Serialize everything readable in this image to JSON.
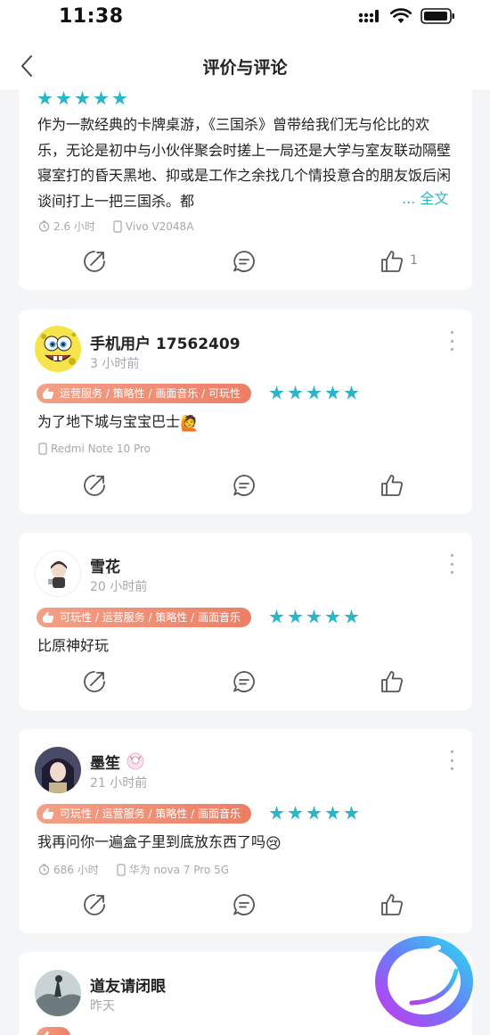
{
  "status": {
    "time": "11:38"
  },
  "nav": {
    "title": "评价与评论"
  },
  "top_review": {
    "text": "作为一款经典的卡牌桌游，《三国杀》曾带给我们无与伦比的欢乐，无论是初中与小伙伴聚会时搓上一局还是大学与室友联动隔壁寝室打的昏天黑地、抑或是工作之余找几个情投意合的朋友饭后闲谈间打上一把三国杀。都",
    "more": "... 全文",
    "playtime": "2.6 小时",
    "device": "Vivo V2048A",
    "likes": "1",
    "rating": 5
  },
  "reviews": [
    {
      "name": "手机用户 17562409",
      "time": "3 小时前",
      "tags": "运营服务 / 策略性 / 画面音乐 / 可玩性",
      "rating": 5,
      "text": "为了地下城与宝宝巴士",
      "emoji": "🙋",
      "device": "Redmi Note 10 Pro"
    },
    {
      "name": "雪花",
      "time": "20 小时前",
      "tags": "可玩性 / 运营服务 / 策略性 / 画面音乐",
      "rating": 5,
      "text": "比原神好玩"
    },
    {
      "name": "墨笙",
      "time": "21 小时前",
      "tags": "可玩性 / 运营服务 / 策略性 / 画面音乐",
      "rating": 5,
      "text": "我再问你一遍盒子里到底放东西了吗",
      "emoji": "😢",
      "playtime": "686 小时",
      "device": "华为 nova 7 Pro 5G"
    },
    {
      "name": "道友请闭眼",
      "time": "昨天"
    }
  ],
  "colors": {
    "accent": "#2bb5c9",
    "tag": "#ec7f66",
    "page_bg": "#f4f5f7"
  },
  "icons": [
    "back-icon",
    "signal-icon",
    "wifi-icon",
    "battery-icon",
    "star-icon",
    "clock-icon",
    "phone-icon",
    "share-icon",
    "comment-icon",
    "thumb-up-icon",
    "more-icon",
    "tag-hand-icon",
    "brand-logo"
  ]
}
